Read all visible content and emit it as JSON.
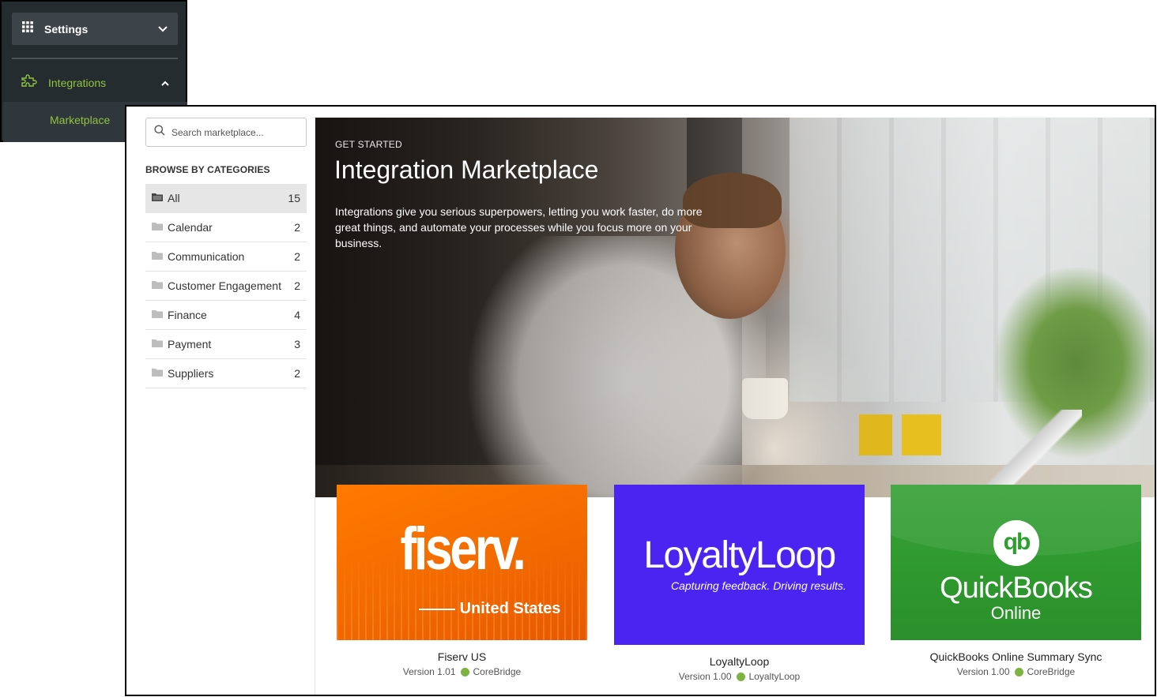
{
  "nav": {
    "settings_label": "Settings",
    "integrations_label": "Integrations",
    "marketplace_label": "Marketplace"
  },
  "search": {
    "placeholder": "Search marketplace..."
  },
  "categories": {
    "title": "BROWSE BY CATEGORIES",
    "items": [
      {
        "name": "All",
        "count": "15",
        "active": true
      },
      {
        "name": "Calendar",
        "count": "2"
      },
      {
        "name": "Communication",
        "count": "2"
      },
      {
        "name": "Customer Engagement",
        "count": "2"
      },
      {
        "name": "Finance",
        "count": "4"
      },
      {
        "name": "Payment",
        "count": "3"
      },
      {
        "name": "Suppliers",
        "count": "2"
      }
    ]
  },
  "hero": {
    "kicker": "GET STARTED",
    "title": "Integration Marketplace",
    "description": "Integrations give you serious superpowers, letting you work faster, do more great things, and automate your processes while you focus more on your business."
  },
  "cards": [
    {
      "name": "Fiserv US",
      "version": "Version 1.01",
      "vendor": "CoreBridge",
      "logo_word": "fiserv.",
      "logo_sub": "United States",
      "color": "#f26a00"
    },
    {
      "name": "LoyaltyLoop",
      "version": "Version 1.00",
      "vendor": "LoyaltyLoop",
      "logo_word": "LoyaltyLoop",
      "logo_tag": "Capturing feedback. Driving results.",
      "color": "#4a24f0"
    },
    {
      "name": "QuickBooks Online Summary Sync",
      "version": "Version 1.00",
      "vendor": "CoreBridge",
      "logo_mark": "qb",
      "logo_word": "QuickBooks",
      "logo_sub": "Online",
      "color": "#2f9a2f"
    }
  ],
  "colors": {
    "accent_green": "#8fc43f",
    "status_dot": "#7cb342",
    "nav_bg": "#252c30"
  }
}
